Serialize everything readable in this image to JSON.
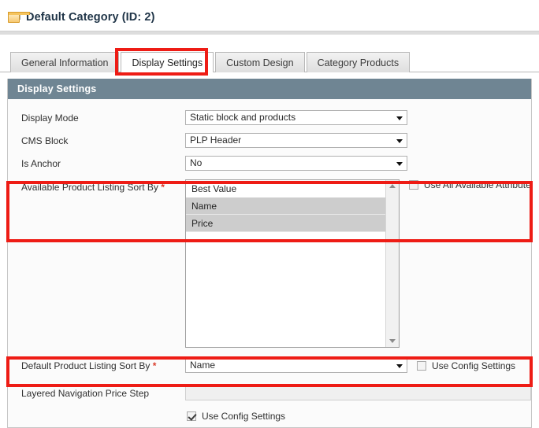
{
  "page": {
    "title": "Default Category (ID: 2)",
    "icon": "category-folder-icon"
  },
  "tabs": [
    {
      "label": "General Information",
      "active": false
    },
    {
      "label": "Display Settings",
      "active": true
    },
    {
      "label": "Custom Design",
      "active": false
    },
    {
      "label": "Category Products",
      "active": false
    }
  ],
  "panel": {
    "header": "Display Settings"
  },
  "fields": {
    "display_mode": {
      "label": "Display Mode",
      "value": "Static block and products"
    },
    "cms_block": {
      "label": "CMS Block",
      "value": "PLP Header"
    },
    "is_anchor": {
      "label": "Is Anchor",
      "value": "No"
    },
    "available_sort_by": {
      "label": "Available Product Listing Sort By",
      "required_marker": "*",
      "options": [
        {
          "label": "Best Value",
          "selected": false
        },
        {
          "label": "Name",
          "selected": true
        },
        {
          "label": "Price",
          "selected": true
        }
      ],
      "checkbox": {
        "label": "Use All Available Attributes",
        "checked": false
      }
    },
    "default_sort_by": {
      "label": "Default Product Listing Sort By",
      "required_marker": "*",
      "value": "Name",
      "checkbox": {
        "label": "Use Config Settings",
        "checked": false
      }
    },
    "price_step": {
      "label": "Layered Navigation Price Step",
      "value": "",
      "checkbox": {
        "label": "Use Config Settings",
        "checked": true
      }
    }
  },
  "annotations": {
    "accent_color": "#ee1c15",
    "boxes": [
      "display-settings-tab",
      "available-sort-by-row",
      "default-sort-by-row"
    ]
  },
  "colors": {
    "panel_header_bg": "#6f8593",
    "required_marker": "#d93c2b",
    "selected_option_bg": "#cdcdcd"
  }
}
